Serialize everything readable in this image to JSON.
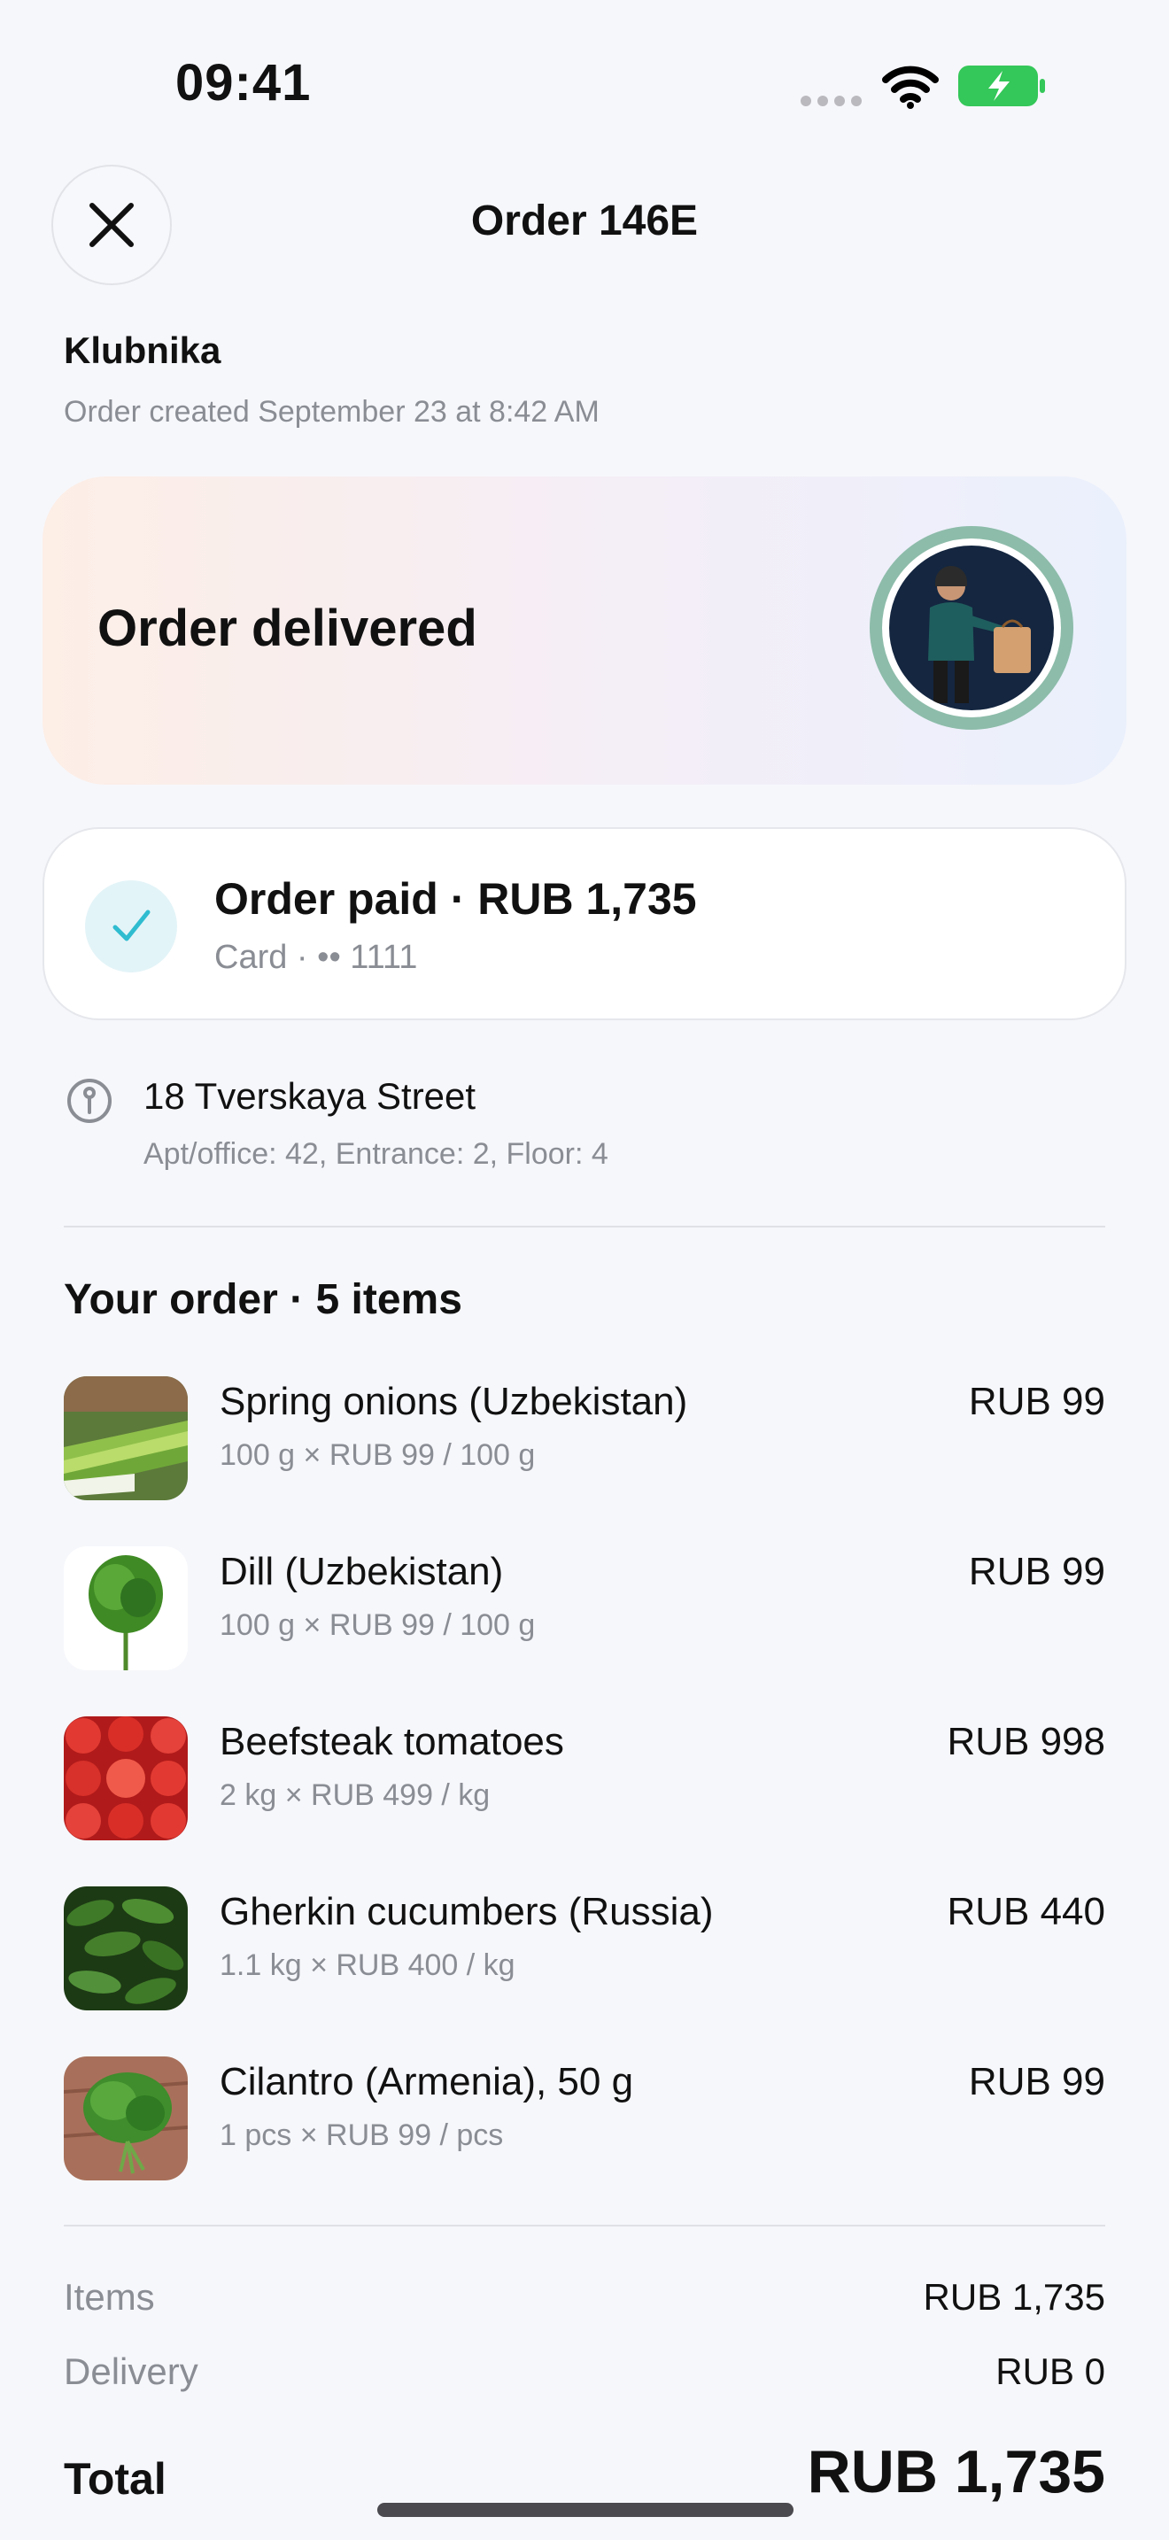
{
  "status_bar": {
    "time": "09:41"
  },
  "header": {
    "title": "Order 146E"
  },
  "store": {
    "name": "Klubnika",
    "created": "Order created September 23 at 8:42 AM"
  },
  "delivery": {
    "status": "Order delivered"
  },
  "payment": {
    "title": "Order paid · RUB 1,735",
    "method": "Card · •• 1111"
  },
  "address": {
    "street": "18 Tverskaya Street",
    "details": "Apt/office: 42, Entrance: 2, Floor: 4"
  },
  "order": {
    "heading": "Your order · 5 items",
    "items": [
      {
        "name": "Spring onions (Uzbekistan)",
        "qty": "100 g × RUB 99 / 100 g",
        "price": "RUB 99"
      },
      {
        "name": "Dill (Uzbekistan)",
        "qty": "100 g × RUB 99 / 100 g",
        "price": "RUB 99"
      },
      {
        "name": "Beefsteak tomatoes",
        "qty": "2 kg × RUB 499 / kg",
        "price": "RUB 998"
      },
      {
        "name": "Gherkin cucumbers (Russia)",
        "qty": "1.1 kg × RUB 400 / kg",
        "price": "RUB 440"
      },
      {
        "name": "Cilantro (Armenia), 50 g",
        "qty": "1 pcs × RUB 99 / pcs",
        "price": "RUB 99"
      }
    ]
  },
  "summary": {
    "items_label": "Items",
    "items_value": "RUB 1,735",
    "delivery_label": "Delivery",
    "delivery_value": "RUB 0",
    "total_label": "Total",
    "total_value": "RUB 1,735"
  },
  "colors": {
    "accent": "#2fbcd0",
    "battery": "#34c759",
    "avatar_ring": "#8dbcaa"
  }
}
